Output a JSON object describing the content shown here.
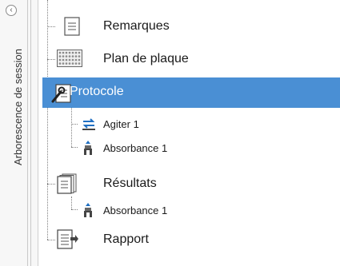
{
  "side_panel": {
    "title": "Arborescence de session",
    "collapse_glyph": "‹"
  },
  "tree": {
    "items": [
      {
        "label": "Remarques",
        "icon": "notes-icon"
      },
      {
        "label": "Plan de plaque",
        "icon": "plate-grid-icon"
      },
      {
        "label": "Protocole",
        "icon": "wrench-document-icon",
        "selected": true,
        "children": [
          {
            "label": "Agiter 1",
            "icon": "shake-arrows-icon"
          },
          {
            "label": "Absorbance 1",
            "icon": "absorbance-icon"
          }
        ]
      },
      {
        "label": "Résultats",
        "icon": "results-documents-icon",
        "children": [
          {
            "label": "Absorbance 1",
            "icon": "absorbance-icon"
          }
        ]
      },
      {
        "label": "Rapport",
        "icon": "report-icon"
      }
    ]
  },
  "colors": {
    "selection": "#4a8fd4",
    "accent_blue": "#1f6fc2"
  }
}
